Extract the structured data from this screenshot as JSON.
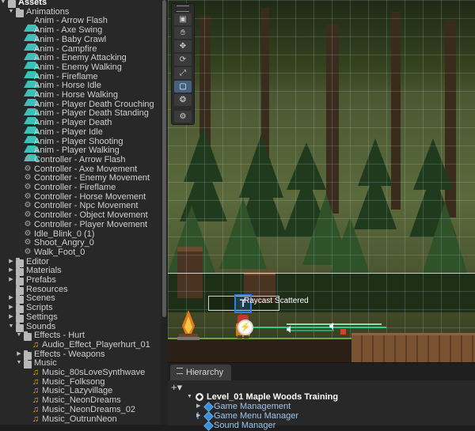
{
  "project": {
    "assets_label": "Assets",
    "animations_label": "Animations",
    "anims": [
      "Anim - Arrow Flash",
      "Anim - Axe Swing",
      "Anim - Baby Crawl",
      "Anim - Campfire",
      "Anim - Enemy Attacking",
      "Anim - Enemy Walking",
      "Anim - Fireflame",
      "Anim - Horse Idle",
      "Anim - Horse Walking",
      "Anim - Player Death Crouching",
      "Anim - Player Death Standing",
      "Anim - Player Death",
      "Anim - Player Idle",
      "Anim - Player Shooting",
      "Anim - Player Walking"
    ],
    "controllers": [
      "Controller - Arrow Flash",
      "Controller - Axe Movement",
      "Controller - Enemy Movement",
      "Controller - Fireflame",
      "Controller - Horse Movement",
      "Controller - Npc Movement",
      "Controller - Object Movement",
      "Controller - Player Movement",
      "Idle_Blink_0 (1)",
      "Shoot_Angry_0",
      "Walk_Foot_0"
    ],
    "folders": [
      "Editor",
      "Materials",
      "Prefabs",
      "Resources",
      "Scenes",
      "Scripts",
      "Settings",
      "Sounds"
    ],
    "effects_hurt_label": "Effects - Hurt",
    "effects_hurt_file": "Audio_Effect_Playerhurt_01",
    "effects_weapons_label": "Effects - Weapons",
    "music_label": "Music",
    "music_files": [
      "Music_80sLoveSynthwave",
      "Music_Folksong",
      "Music_Lazyvillage",
      "Music_NeonDreams",
      "Music_NeonDreams_02",
      "Music_OutrunNeon"
    ]
  },
  "scene": {
    "raycast_label": "Raycast Scattered",
    "tools": [
      "view-2d",
      "hand",
      "move",
      "rotate",
      "scale",
      "rect",
      "transform",
      "custom"
    ],
    "active_tool": "rect"
  },
  "hierarchy": {
    "tab_label": "Hierarchy",
    "add_label": "+▾",
    "scene_name": "Level_01 Maple Woods Training",
    "items": [
      "Game Management",
      "Game Menu Manager",
      "Sound Manager"
    ]
  },
  "colors": {
    "accent": "#3a8fd8",
    "anim_icon": "#3cc0b8",
    "audio_icon": "#e2ad23",
    "selection": "#46607f"
  }
}
